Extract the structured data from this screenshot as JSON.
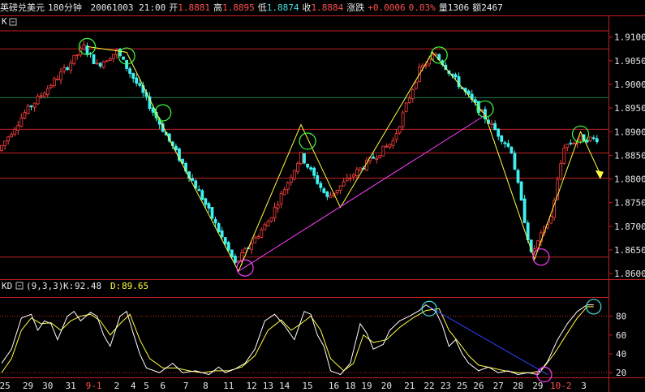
{
  "header": {
    "symbol": "英磅兑美元",
    "period": "180分钟",
    "datetime": "20061003 21:00",
    "open_label": "开",
    "open": "1.8881",
    "high_label": "高",
    "high": "1.8895",
    "low_label": "低",
    "low": "1.8874",
    "close_label": "收",
    "close": "1.8884",
    "change_label": "涨跌",
    "change": "+0.0006",
    "change_pct": "0.03%",
    "volume_label": "量",
    "volume": "1306",
    "amount_label": "额",
    "amount": "2467"
  },
  "main_panel": {
    "label": "K"
  },
  "kd_panel": {
    "label": "KD",
    "params": "(9,3,3)",
    "k_label": "K:",
    "k_value": "92.48",
    "d_label": "D:",
    "d_value": "89.65"
  },
  "colors": {
    "up": "#ff4040",
    "down": "#40f0f0",
    "grid": "#c02020",
    "k_line": "#ffffff",
    "d_line": "#ffff40",
    "yellow_line": "#ffff40",
    "magenta_line": "#ff40ff",
    "blue_line": "#3040ff",
    "circle_green": "#40ff40",
    "circle_cyan": "#40e0e0",
    "circle_magenta": "#ff40ff"
  },
  "chart_data": [
    {
      "type": "candlestick",
      "ylim": [
        1.8595,
        1.9115
      ],
      "y_ticks": [
        "1.9100",
        "1.9050",
        "1.9000",
        "1.8950",
        "1.8900",
        "1.8850",
        "1.8800",
        "1.8750",
        "1.8700",
        "1.8650",
        "1.8600"
      ],
      "y_tick_values": [
        1.91,
        1.905,
        1.9,
        1.895,
        1.89,
        1.885,
        1.88,
        1.875,
        1.87,
        1.865,
        1.86
      ],
      "horizontal_levels": [
        1.9075,
        1.8905,
        1.8855,
        1.8802,
        1.8635
      ],
      "green_level": 1.8972,
      "keypoints": [
        {
          "i": 0,
          "p": 1.886
        },
        {
          "i": 8,
          "p": 1.894
        },
        {
          "i": 20,
          "p": 1.903
        },
        {
          "i": 26,
          "p": 1.908
        },
        {
          "i": 30,
          "p": 1.904
        },
        {
          "i": 36,
          "p": 1.907
        },
        {
          "i": 44,
          "p": 1.898
        },
        {
          "i": 52,
          "p": 1.888
        },
        {
          "i": 62,
          "p": 1.876
        },
        {
          "i": 72,
          "p": 1.862
        },
        {
          "i": 82,
          "p": 1.871
        },
        {
          "i": 92,
          "p": 1.885
        },
        {
          "i": 100,
          "p": 1.876
        },
        {
          "i": 108,
          "p": 1.881
        },
        {
          "i": 120,
          "p": 1.888
        },
        {
          "i": 128,
          "p": 1.903
        },
        {
          "i": 133,
          "p": 1.9065
        },
        {
          "i": 140,
          "p": 1.9
        },
        {
          "i": 148,
          "p": 1.893
        },
        {
          "i": 156,
          "p": 1.886
        },
        {
          "i": 162,
          "p": 1.864
        },
        {
          "i": 168,
          "p": 1.872
        },
        {
          "i": 172,
          "p": 1.887
        },
        {
          "i": 177,
          "p": 1.8885
        }
      ],
      "yellow_path": [
        [
          26,
          1.908
        ],
        [
          38,
          1.9068
        ],
        [
          52,
          1.887
        ],
        [
          72,
          1.8605
        ],
        [
          91,
          1.8915
        ],
        [
          103,
          1.874
        ],
        [
          131,
          1.9068
        ],
        [
          147,
          1.8935
        ],
        [
          162,
          1.863
        ],
        [
          176,
          1.89
        ],
        [
          182,
          1.881
        ]
      ],
      "magenta_path": [
        [
          72,
          1.8605
        ],
        [
          147,
          1.8935
        ]
      ],
      "circles": [
        {
          "i": 26,
          "p": 1.908,
          "c": "green"
        },
        {
          "i": 38,
          "p": 1.906,
          "c": "green"
        },
        {
          "i": 49,
          "p": 1.894,
          "c": "green"
        },
        {
          "i": 93,
          "p": 1.888,
          "c": "green"
        },
        {
          "i": 133,
          "p": 1.9062,
          "c": "green"
        },
        {
          "i": 147,
          "p": 1.8948,
          "c": "green"
        },
        {
          "i": 176,
          "p": 1.8895,
          "c": "green"
        },
        {
          "i": 74,
          "p": 1.8612,
          "c": "magenta"
        },
        {
          "i": 164,
          "p": 1.8635,
          "c": "magenta"
        }
      ]
    },
    {
      "type": "line",
      "ylim": [
        15,
        102
      ],
      "y_ticks": [
        "80",
        "60",
        "40",
        "20"
      ],
      "y_tick_values": [
        80,
        60,
        40,
        20
      ],
      "x_tick_labels": [
        "25",
        "29",
        "30",
        "31",
        "9-1",
        "2",
        "4",
        "5",
        "6",
        "7",
        "8",
        "11",
        "12",
        "13",
        "14",
        "15",
        "16",
        "18",
        "19",
        "20",
        "21",
        "22",
        "23",
        "25",
        "26",
        "27",
        "28",
        "29",
        "10-2",
        "3"
      ],
      "x_tick_index": [
        1,
        8,
        14,
        21,
        28,
        35,
        40,
        44,
        49,
        56,
        62,
        69,
        76,
        81,
        86,
        93,
        101,
        106,
        111,
        117,
        124,
        130,
        135,
        140,
        145,
        151,
        157,
        163,
        170,
        177
      ],
      "series": [
        {
          "name": "K",
          "keypoints": [
            [
              0,
              30
            ],
            [
              3,
              45
            ],
            [
              6,
              78
            ],
            [
              9,
              82
            ],
            [
              11,
              65
            ],
            [
              13,
              75
            ],
            [
              15,
              72
            ],
            [
              17,
              55
            ],
            [
              20,
              80
            ],
            [
              22,
              85
            ],
            [
              24,
              75
            ],
            [
              27,
              84
            ],
            [
              29,
              80
            ],
            [
              31,
              60
            ],
            [
              33,
              48
            ],
            [
              36,
              80
            ],
            [
              38,
              85
            ],
            [
              40,
              62
            ],
            [
              42,
              40
            ],
            [
              44,
              25
            ],
            [
              48,
              20
            ],
            [
              52,
              30
            ],
            [
              55,
              20
            ],
            [
              59,
              22
            ],
            [
              63,
              18
            ],
            [
              66,
              26
            ],
            [
              68,
              20
            ],
            [
              71,
              24
            ],
            [
              74,
              30
            ],
            [
              77,
              45
            ],
            [
              80,
              75
            ],
            [
              83,
              82
            ],
            [
              86,
              70
            ],
            [
              89,
              55
            ],
            [
              92,
              85
            ],
            [
              94,
              82
            ],
            [
              96,
              60
            ],
            [
              98,
              48
            ],
            [
              100,
              22
            ],
            [
              103,
              18
            ],
            [
              106,
              30
            ],
            [
              109,
              72
            ],
            [
              111,
              62
            ],
            [
              113,
              45
            ],
            [
              116,
              50
            ],
            [
              118,
              65
            ],
            [
              121,
              75
            ],
            [
              124,
              80
            ],
            [
              127,
              86
            ],
            [
              129,
              92
            ],
            [
              132,
              85
            ],
            [
              134,
              70
            ],
            [
              136,
              48
            ],
            [
              138,
              55
            ],
            [
              140,
              40
            ],
            [
              142,
              30
            ],
            [
              145,
              22
            ],
            [
              148,
              26
            ],
            [
              151,
              20
            ],
            [
              154,
              22
            ],
            [
              157,
              18
            ],
            [
              160,
              20
            ],
            [
              163,
              18
            ],
            [
              166,
              32
            ],
            [
              169,
              55
            ],
            [
              172,
              72
            ],
            [
              175,
              85
            ],
            [
              178,
              92
            ]
          ]
        },
        {
          "name": "D",
          "keypoints": [
            [
              0,
              20
            ],
            [
              3,
              35
            ],
            [
              6,
              65
            ],
            [
              9,
              78
            ],
            [
              12,
              72
            ],
            [
              15,
              73
            ],
            [
              18,
              65
            ],
            [
              21,
              75
            ],
            [
              24,
              80
            ],
            [
              27,
              82
            ],
            [
              30,
              75
            ],
            [
              33,
              60
            ],
            [
              36,
              72
            ],
            [
              39,
              82
            ],
            [
              42,
              55
            ],
            [
              45,
              35
            ],
            [
              49,
              25
            ],
            [
              53,
              25
            ],
            [
              57,
              22
            ],
            [
              61,
              20
            ],
            [
              65,
              22
            ],
            [
              69,
              22
            ],
            [
              73,
              26
            ],
            [
              77,
              38
            ],
            [
              81,
              65
            ],
            [
              85,
              76
            ],
            [
              88,
              65
            ],
            [
              91,
              72
            ],
            [
              94,
              80
            ],
            [
              97,
              65
            ],
            [
              100,
              35
            ],
            [
              104,
              22
            ],
            [
              107,
              30
            ],
            [
              110,
              60
            ],
            [
              113,
              52
            ],
            [
              117,
              55
            ],
            [
              121,
              68
            ],
            [
              125,
              78
            ],
            [
              129,
              86
            ],
            [
              133,
              88
            ],
            [
              136,
              65
            ],
            [
              139,
              52
            ],
            [
              142,
              38
            ],
            [
              145,
              28
            ],
            [
              149,
              25
            ],
            [
              153,
              22
            ],
            [
              157,
              20
            ],
            [
              161,
              20
            ],
            [
              164,
              22
            ],
            [
              168,
              40
            ],
            [
              172,
              62
            ],
            [
              175,
              78
            ],
            [
              178,
              90
            ]
          ]
        }
      ],
      "blue_path": [
        [
          130,
          90
        ],
        [
          166,
          18
        ]
      ],
      "circles": [
        {
          "i": 130,
          "v": 88,
          "c": "cyan"
        },
        {
          "i": 180,
          "v": 90,
          "c": "cyan"
        },
        {
          "i": 165,
          "v": 18,
          "c": "magenta"
        }
      ]
    }
  ]
}
